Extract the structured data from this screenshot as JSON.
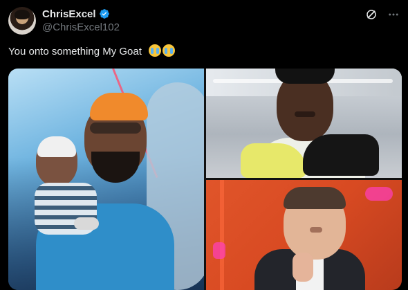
{
  "tweet": {
    "display_name": "ChrisExcel",
    "handle": "@ChrisExcel102",
    "text": "You onto something My Goat",
    "emojis": [
      "loudly-crying-face",
      "loudly-crying-face"
    ]
  },
  "icons": {
    "verified": "verified-badge-icon",
    "grok": "grok-icon",
    "more": "more-icon"
  },
  "colors": {
    "background": "#000000",
    "text_primary": "#e7e9ea",
    "text_secondary": "#71767b",
    "verified_blue": "#1d9bf0"
  },
  "media": {
    "photos": [
      {
        "description_name": "photo-left-man-holding-baby"
      },
      {
        "description_name": "photo-top-right-man-with-shoes"
      },
      {
        "description_name": "photo-bottom-right-man-gesturing"
      }
    ]
  }
}
